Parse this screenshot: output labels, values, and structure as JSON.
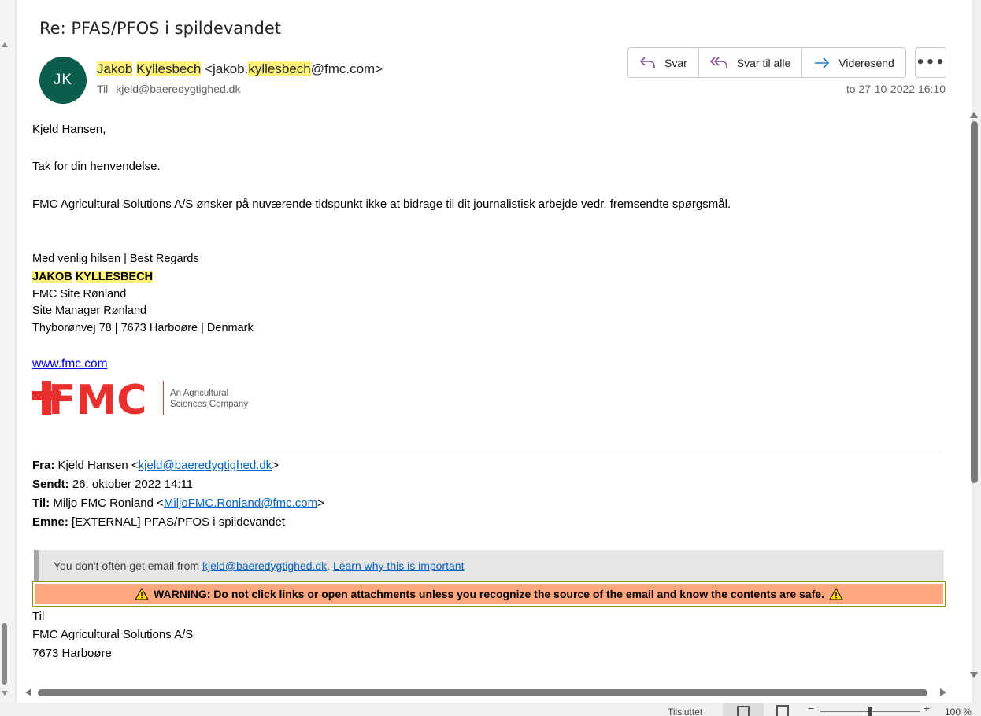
{
  "header": {
    "subject": "Re: PFAS/PFOS i spildevandet",
    "avatar_initials": "JK",
    "sender_first": "Jakob",
    "sender_last": "Kyllesbech",
    "sender_email_prefix": "<jakob.",
    "sender_email_hl": "kyllesbech",
    "sender_email_suffix": "@fmc.com>",
    "to_label": "Til",
    "to_address": "kjeld@baeredygtighed.dk",
    "date": "to 27-10-2022 16:10",
    "avatar_color": "#0b5e4d",
    "highlight_color": "#fff17a"
  },
  "actions": {
    "reply": "Svar",
    "reply_all": "Svar til alle",
    "forward": "Videresend",
    "more": "•••"
  },
  "body": {
    "greeting": "Kjeld Hansen,",
    "line1": "Tak for din henvendelse.",
    "line2": "FMC Agricultural Solutions A/S ønsker på nuværende tidspunkt ikke at bidrage til dit journalistisk arbejde vedr. fremsendte spørgsmål."
  },
  "signature": {
    "regards": "Med venlig hilsen | Best Regards",
    "name_first": "JAKOB",
    "name_last": "KYLLESBECH",
    "site": "FMC Site Rønland",
    "title": "Site Manager Rønland",
    "address": "Thyborønvej 78 | 7673 Harboøre | Denmark",
    "website": "www.fmc.com",
    "logo_text": "FMC",
    "logo_tagline_1": "An Agricultural",
    "logo_tagline_2": "Sciences Company",
    "logo_color": "#e8312f"
  },
  "quoted": {
    "from_label": "Fra:",
    "from_name": "Kjeld Hansen <",
    "from_email": "kjeld@baeredygtighed.dk",
    "from_close": ">",
    "sent_label": "Sendt:",
    "sent_value": "26. oktober 2022 14:11",
    "to_label": "Til:",
    "to_name": "Miljo FMC Ronland <",
    "to_email": "MiljoFMC.Ronland@fmc.com",
    "to_close": ">",
    "subject_label": "Emne:",
    "subject_value": "[EXTERNAL] PFAS/PFOS i spildevandet"
  },
  "notice": {
    "text": "You don't often get email from",
    "email": "kjeld@baeredygtighed.dk",
    "dot": ".",
    "learn": "Learn why this is important"
  },
  "warning": {
    "text": "WARNING: Do not click links or open attachments unless you recognize the source of the email and know the contents are safe.",
    "bg_color": "#ffa77f"
  },
  "quoted_body": {
    "line1": "Til",
    "line2": "FMC Agricultural Solutions A/S",
    "line3": "7673 Harboøre"
  },
  "status_bar": {
    "connection": "Tilsluttet",
    "zoom": "100 %"
  }
}
